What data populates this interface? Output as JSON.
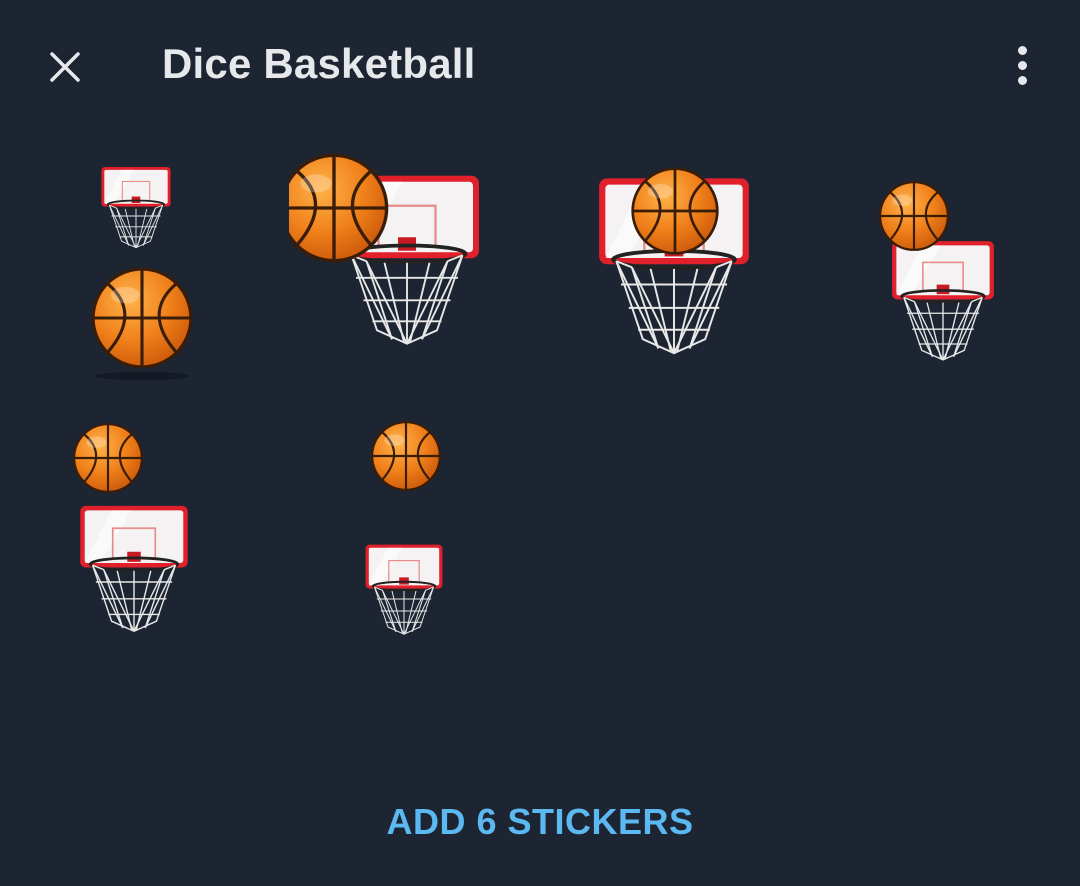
{
  "header": {
    "title": "Dice Basketball",
    "close_icon": "close-icon",
    "menu_icon": "more-vertical-icon"
  },
  "stickers": [
    {
      "id": "sticker-1",
      "description": "hoop with ball below"
    },
    {
      "id": "sticker-2",
      "description": "ball hitting backboard"
    },
    {
      "id": "sticker-3",
      "description": "ball in rim"
    },
    {
      "id": "sticker-4",
      "description": "ball above hoop"
    },
    {
      "id": "sticker-5",
      "description": "ball above hoop"
    },
    {
      "id": "sticker-6",
      "description": "ball above small hoop"
    }
  ],
  "footer": {
    "add_label": "ADD 6 STICKERS"
  },
  "colors": {
    "background": "#1e2532",
    "accent": "#5bb8f0",
    "ball": "#f28a1e",
    "rim": "#e0202a"
  }
}
